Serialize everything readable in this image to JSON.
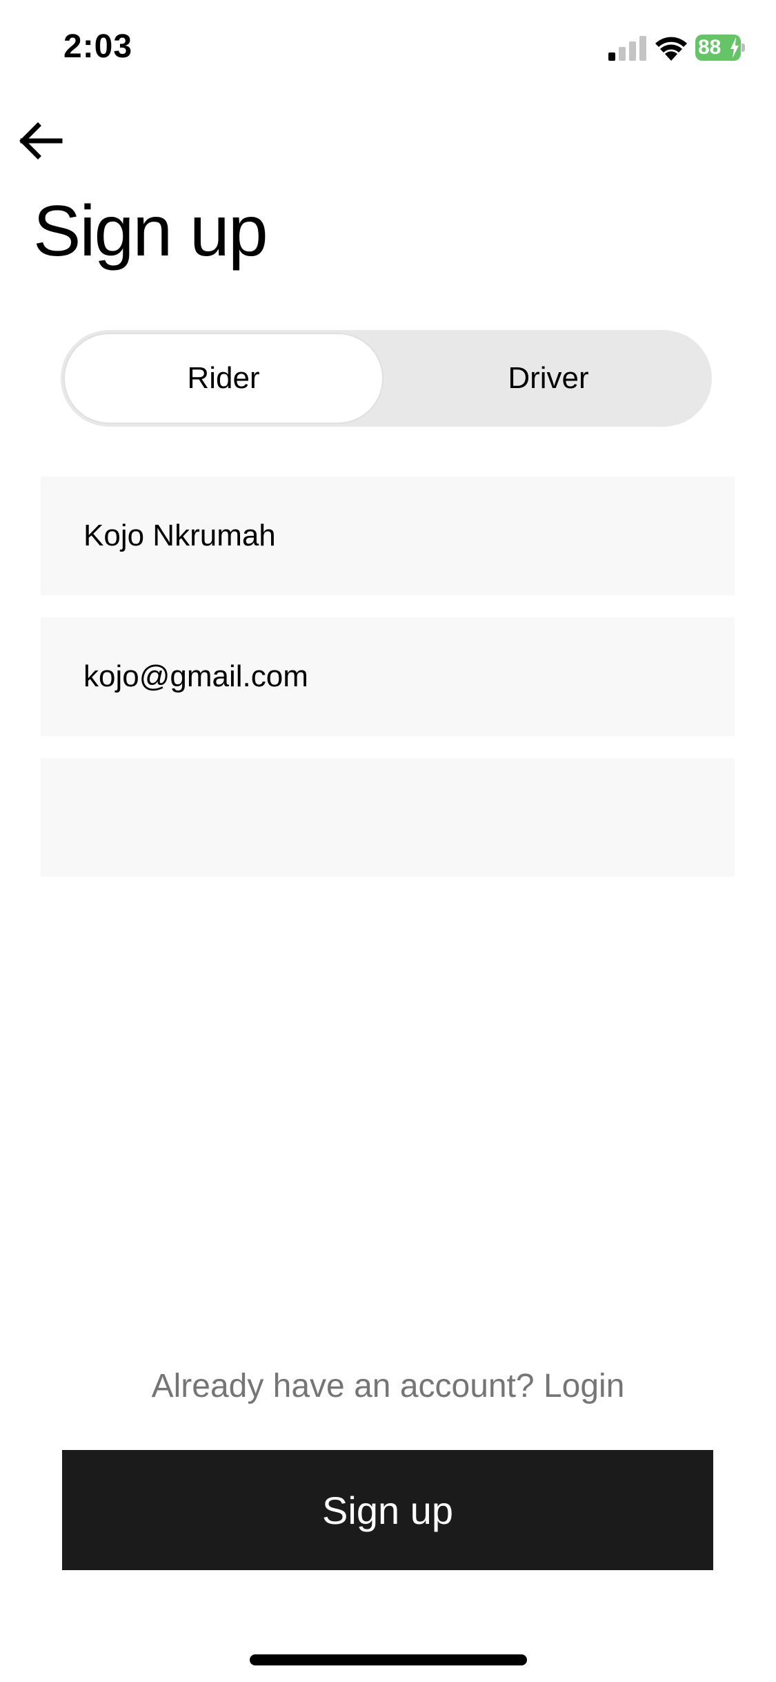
{
  "status_bar": {
    "time": "2:03",
    "battery_level": "88",
    "battery_color": "#65c466",
    "icons": [
      "signal-icon",
      "wifi-icon",
      "battery-icon",
      "charging-bolt-icon"
    ]
  },
  "header": {
    "back_icon": "arrow-left-icon",
    "title": "Sign up"
  },
  "role_toggle": {
    "options": [
      {
        "label": "Rider",
        "selected": true
      },
      {
        "label": "Driver",
        "selected": false
      }
    ]
  },
  "form": {
    "name_value": "Kojo Nkrumah",
    "email_value": "kojo@gmail.com",
    "password_value": ""
  },
  "footer": {
    "login_prompt": "Already have an account?",
    "login_link": "Login",
    "signup_label": "Sign up"
  },
  "colors": {
    "button_bg": "#1b1b1b",
    "field_bg": "#f8f8f8",
    "toggle_bg": "#e8e8e8",
    "muted_text": "#757575"
  }
}
